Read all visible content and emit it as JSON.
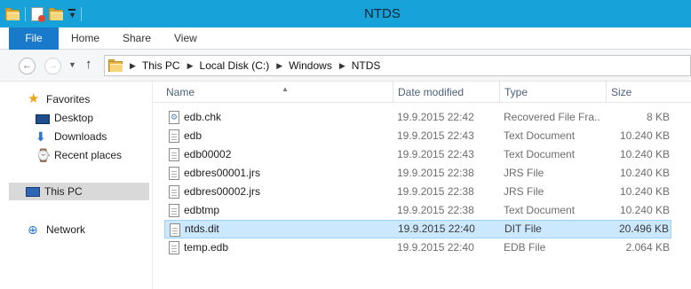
{
  "window": {
    "title": "NTDS"
  },
  "ribbon": {
    "tabs": [
      "File",
      "Home",
      "Share",
      "View"
    ]
  },
  "address": {
    "crumbs": [
      "This PC",
      "Local Disk (C:)",
      "Windows",
      "NTDS"
    ]
  },
  "nav": {
    "favorites": "Favorites",
    "desktop": "Desktop",
    "downloads": "Downloads",
    "recent": "Recent places",
    "thispc": "This PC",
    "network": "Network"
  },
  "columns": {
    "name": "Name",
    "date": "Date modified",
    "type": "Type",
    "size": "Size"
  },
  "files": [
    {
      "name": "edb.chk",
      "date": "19.9.2015 22:42",
      "type": "Recovered File Fra...",
      "size": "8 KB",
      "icon": "checkpoint-file-icon"
    },
    {
      "name": "edb",
      "date": "19.9.2015 22:43",
      "type": "Text Document",
      "size": "10.240 KB",
      "icon": "text-file-icon"
    },
    {
      "name": "edb00002",
      "date": "19.9.2015 22:43",
      "type": "Text Document",
      "size": "10.240 KB",
      "icon": "text-file-icon"
    },
    {
      "name": "edbres00001.jrs",
      "date": "19.9.2015 22:38",
      "type": "JRS File",
      "size": "10.240 KB",
      "icon": "file-icon"
    },
    {
      "name": "edbres00002.jrs",
      "date": "19.9.2015 22:38",
      "type": "JRS File",
      "size": "10.240 KB",
      "icon": "file-icon"
    },
    {
      "name": "edbtmp",
      "date": "19.9.2015 22:38",
      "type": "Text Document",
      "size": "10.240 KB",
      "icon": "text-file-icon"
    },
    {
      "name": "ntds.dit",
      "date": "19.9.2015 22:40",
      "type": "DIT File",
      "size": "20.496 KB",
      "icon": "file-icon",
      "selected": true
    },
    {
      "name": "temp.edb",
      "date": "19.9.2015 22:40",
      "type": "EDB File",
      "size": "2.064 KB",
      "icon": "file-icon"
    }
  ],
  "colors": {
    "titlebar": "#17a2da",
    "file_tab": "#1979ca",
    "selection": "#cce8ff"
  }
}
